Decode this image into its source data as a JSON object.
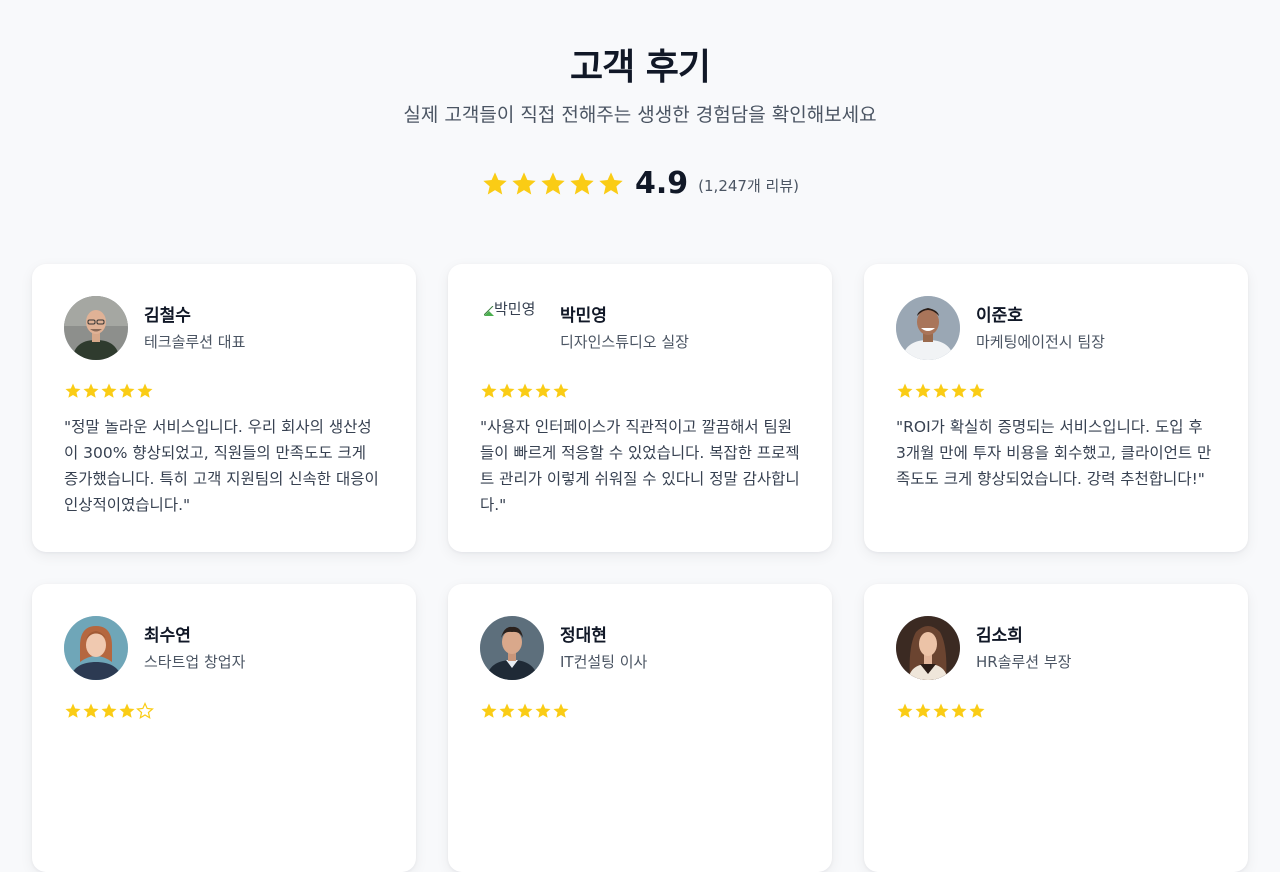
{
  "header": {
    "title": "고객 후기",
    "subtitle": "실제 고객들이 직접 전해주는 생생한 경험담을 확인해보세요"
  },
  "overall": {
    "score": "4.9",
    "count": "(1,247개 리뷰)",
    "stars": 5
  },
  "colors": {
    "star": "#facc15",
    "background": "#f8f9fb",
    "card": "#ffffff"
  },
  "reviews": [
    {
      "name": "김철수",
      "role": "테크솔루션 대표",
      "rating": 5,
      "avatar_alt": "",
      "quote": "\"정말 놀라운 서비스입니다. 우리 회사의 생산성이 300% 향상되었고, 직원들의 만족도도 크게 증가했습니다. 특히 고객 지원팀의 신속한 대응이 인상적이였습니다.\""
    },
    {
      "name": "박민영",
      "role": "디자인스튜디오 실장",
      "rating": 5,
      "avatar_alt": "박민영",
      "quote": "\"사용자 인터페이스가 직관적이고 깔끔해서 팀원들이 빠르게 적응할 수 있었습니다. 복잡한 프로젝트 관리가 이렇게 쉬워질 수 있다니 정말 감사합니다.\""
    },
    {
      "name": "이준호",
      "role": "마케팅에이전시 팀장",
      "rating": 5,
      "avatar_alt": "",
      "quote": "\"ROI가 확실히 증명되는 서비스입니다. 도입 후 3개월 만에 투자 비용을 회수했고, 클라이언트 만족도도 크게 향상되었습니다. 강력 추천합니다!\""
    },
    {
      "name": "최수연",
      "role": "스타트업 창업자",
      "rating": 4,
      "avatar_alt": "",
      "quote": ""
    },
    {
      "name": "정대현",
      "role": "IT컨설팅 이사",
      "rating": 5,
      "avatar_alt": "",
      "quote": ""
    },
    {
      "name": "김소희",
      "role": "HR솔루션 부장",
      "rating": 5,
      "avatar_alt": "",
      "quote": ""
    }
  ]
}
